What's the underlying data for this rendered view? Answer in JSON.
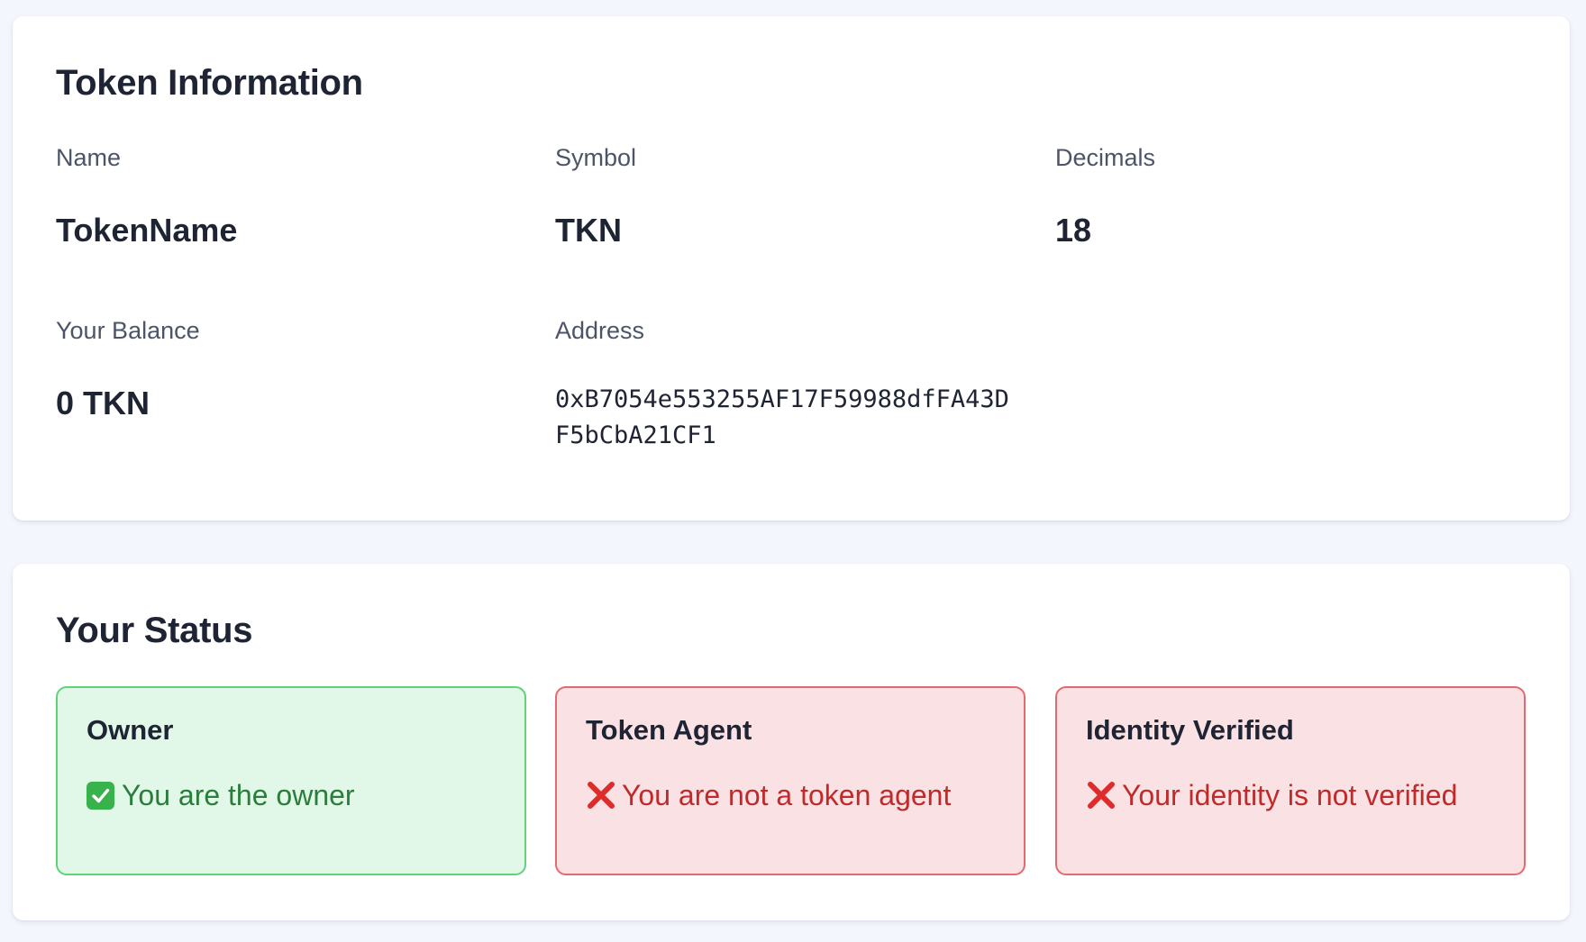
{
  "token_info": {
    "title": "Token Information",
    "name_label": "Name",
    "name_value": "TokenName",
    "symbol_label": "Symbol",
    "symbol_value": "TKN",
    "decimals_label": "Decimals",
    "decimals_value": "18",
    "balance_label": "Your Balance",
    "balance_value": "0 TKN",
    "address_label": "Address",
    "address_value": "0xB7054e553255AF17F59988dfFA43DF5bCbA21CF1"
  },
  "status": {
    "title": "Your Status",
    "owner": {
      "title": "Owner",
      "message": "You are the owner",
      "icon": "check-mark-icon",
      "state": "ok"
    },
    "agent": {
      "title": "Token Agent",
      "message": "You are not a token agent",
      "icon": "cross-mark-icon",
      "state": "bad"
    },
    "identity": {
      "title": "Identity Verified",
      "message": "Your identity is not verified",
      "icon": "cross-mark-icon",
      "state": "bad"
    }
  },
  "colors": {
    "page_background": "#f3f6fd",
    "ok_background": "#e1f8e8",
    "ok_border": "#5fd27a",
    "ok_text": "#2a7d3a",
    "bad_background": "#fae2e4",
    "bad_border": "#e36a6f",
    "bad_text": "#c02a2a"
  }
}
